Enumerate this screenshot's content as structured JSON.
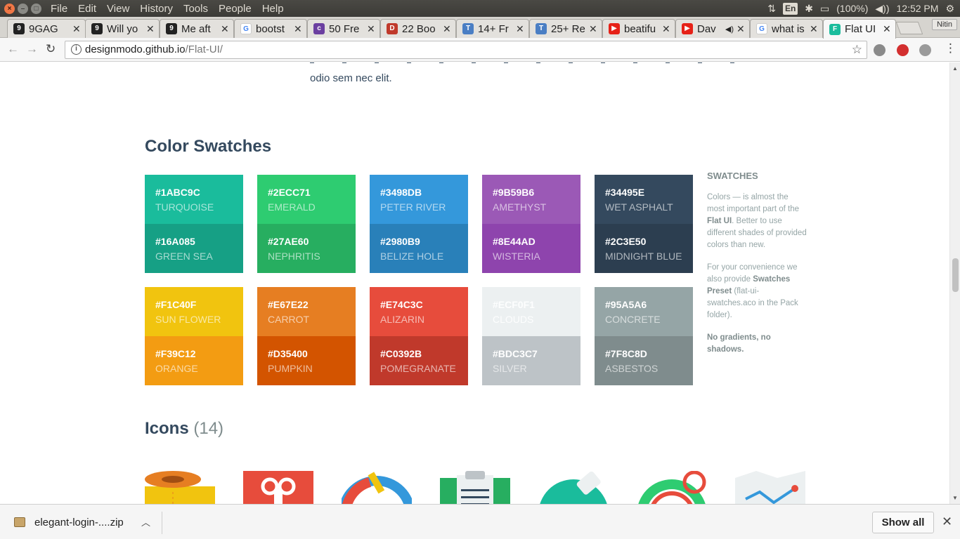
{
  "os": {
    "menu": [
      "File",
      "Edit",
      "View",
      "History",
      "Tools",
      "People",
      "Help"
    ],
    "lang": "En",
    "battery": "(100%)",
    "time": "12:52 PM"
  },
  "tabs": [
    {
      "title": "9GAG",
      "fav_color": "#222222",
      "fav_text": "9"
    },
    {
      "title": "Will yo",
      "fav_color": "#222222",
      "fav_text": "9"
    },
    {
      "title": "Me aft",
      "fav_color": "#222222",
      "fav_text": "9"
    },
    {
      "title": "bootst",
      "fav_color": "#ffffff",
      "fav_text": "G"
    },
    {
      "title": "50 Fre",
      "fav_color": "#6b3fa0",
      "fav_text": "c"
    },
    {
      "title": "22 Boo",
      "fav_color": "#c0392b",
      "fav_text": "D"
    },
    {
      "title": "14+ Fr",
      "fav_color": "#4a7ec4",
      "fav_text": "T"
    },
    {
      "title": "25+ Re",
      "fav_color": "#4a7ec4",
      "fav_text": "T"
    },
    {
      "title": "beatifu",
      "fav_color": "#e62117",
      "fav_text": "▶"
    },
    {
      "title": "Dav",
      "fav_color": "#e62117",
      "fav_text": "▶"
    },
    {
      "title": "what is",
      "fav_color": "#ffffff",
      "fav_text": "G"
    },
    {
      "title": "Flat UI",
      "fav_color": "#1abc9c",
      "fav_text": "F"
    }
  ],
  "profile_name": "Nitin",
  "omnibox": {
    "host": "designmodo.github.io",
    "path": "/Flat-UI/"
  },
  "intro_tail": "odio sem nec elit.",
  "sections": {
    "swatches_title": "Color Swatches",
    "icons_title": "Icons",
    "icons_count": "(14)"
  },
  "swatches": [
    {
      "top": {
        "hex": "#1ABC9C",
        "name": "TURQUOISE",
        "color": "#1ABC9C"
      },
      "bottom": {
        "hex": "#16A085",
        "name": "GREEN SEA",
        "color": "#16A085"
      }
    },
    {
      "top": {
        "hex": "#2ECC71",
        "name": "EMERALD",
        "color": "#2ECC71"
      },
      "bottom": {
        "hex": "#27AE60",
        "name": "NEPHRITIS",
        "color": "#27AE60"
      }
    },
    {
      "top": {
        "hex": "#3498DB",
        "name": "PETER RIVER",
        "color": "#3498DB"
      },
      "bottom": {
        "hex": "#2980B9",
        "name": "BELIZE HOLE",
        "color": "#2980B9"
      }
    },
    {
      "top": {
        "hex": "#9B59B6",
        "name": "AMETHYST",
        "color": "#9B59B6"
      },
      "bottom": {
        "hex": "#8E44AD",
        "name": "WISTERIA",
        "color": "#8E44AD"
      }
    },
    {
      "top": {
        "hex": "#34495E",
        "name": "WET ASPHALT",
        "color": "#34495E"
      },
      "bottom": {
        "hex": "#2C3E50",
        "name": "MIDNIGHT BLUE",
        "color": "#2C3E50"
      }
    },
    {
      "top": {
        "hex": "#F1C40F",
        "name": "SUN FLOWER",
        "color": "#F1C40F"
      },
      "bottom": {
        "hex": "#F39C12",
        "name": "ORANGE",
        "color": "#F39C12"
      }
    },
    {
      "top": {
        "hex": "#E67E22",
        "name": "CARROT",
        "color": "#E67E22"
      },
      "bottom": {
        "hex": "#D35400",
        "name": "PUMPKIN",
        "color": "#D35400"
      }
    },
    {
      "top": {
        "hex": "#E74C3C",
        "name": "ALIZARIN",
        "color": "#E74C3C"
      },
      "bottom": {
        "hex": "#C0392B",
        "name": "POMEGRANATE",
        "color": "#C0392B"
      }
    },
    {
      "top": {
        "hex": "#ECF0F1",
        "name": "CLOUDS",
        "color": "#ECF0F1"
      },
      "bottom": {
        "hex": "#BDC3C7",
        "name": "SILVER",
        "color": "#BDC3C7"
      }
    },
    {
      "top": {
        "hex": "#95A5A6",
        "name": "CONCRETE",
        "color": "#95A5A6"
      },
      "bottom": {
        "hex": "#7F8C8D",
        "name": "ASBESTOS",
        "color": "#7F8C8D"
      }
    }
  ],
  "sidebar": {
    "heading": "SWATCHES",
    "p1_a": "Colors — is almost the most important part of the ",
    "p1_b": "Flat UI",
    "p1_c": ". Better to use different shades of provided colors than new.",
    "p2_a": "For your convenience we also provide ",
    "p2_b": "Swatches Preset",
    "p2_c": " (flat-ui-swatches.aco in the Pack folder).",
    "p3": "No gradients, no shadows."
  },
  "download": {
    "file": "elegant-login-....zip",
    "show_all": "Show all"
  }
}
